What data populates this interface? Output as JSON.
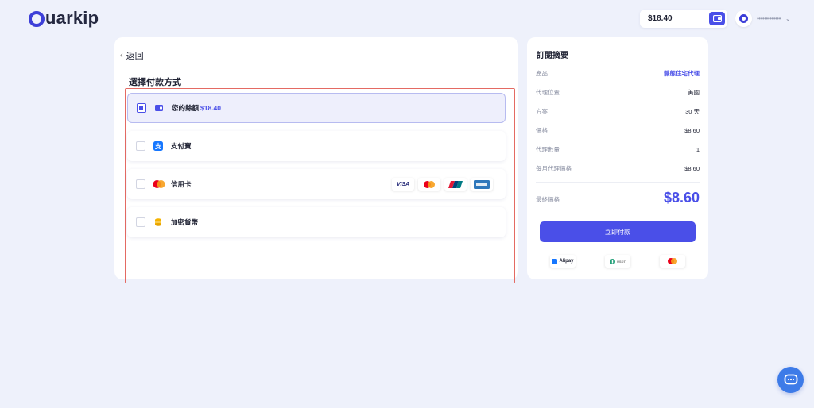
{
  "header": {
    "logo_text": "uarkip",
    "balance": "$18.40",
    "user_name": "•••••••••••••"
  },
  "payment": {
    "back_label": "返回",
    "section_title": "選擇付款方式",
    "options": [
      {
        "label": "您的餘額",
        "amount": "$18.40",
        "selected": true
      },
      {
        "label": "支付寶",
        "selected": false
      },
      {
        "label": "信用卡",
        "selected": false
      },
      {
        "label": "加密貨幣",
        "selected": false
      }
    ],
    "card_brands": [
      "VISA",
      "mastercard",
      "unionpay",
      "amex"
    ]
  },
  "summary": {
    "title": "訂閱摘要",
    "rows": [
      {
        "key": "產品",
        "value": "靜態住宅代理"
      },
      {
        "key": "代理位置",
        "value": "美國"
      },
      {
        "key": "方案",
        "value": "30 天"
      },
      {
        "key": "價格",
        "value": "$8.60"
      },
      {
        "key": "代理數量",
        "value": "1"
      },
      {
        "key": "每月代理價格",
        "value": "$8.60"
      }
    ],
    "final_label": "最終價格",
    "final_price": "$8.60",
    "pay_button": "立即付款",
    "pay_logos": [
      "Alipay",
      "USDT",
      "mastercard"
    ]
  },
  "colors": {
    "accent": "#4a4fe8",
    "background": "#eef1fb",
    "highlight_border": "#e46a63"
  }
}
